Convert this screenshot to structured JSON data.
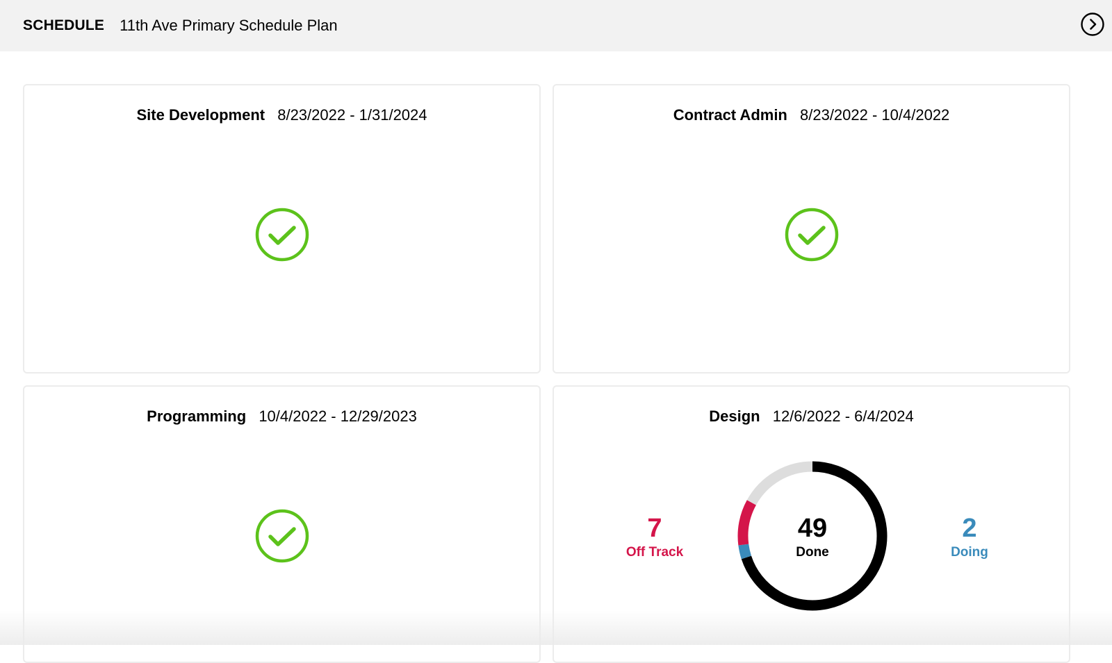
{
  "header": {
    "section_label": "SCHEDULE",
    "plan_name": "11th Ave Primary Schedule Plan",
    "nav_icon": "chevron-right-circle-icon"
  },
  "cards": [
    {
      "name": "Site Development",
      "dates": "8/23/2022 - 1/31/2024",
      "status_icon": "check-circle-icon",
      "status": "complete"
    },
    {
      "name": "Contract Admin",
      "dates": "8/23/2022 - 10/4/2022",
      "status_icon": "check-circle-icon",
      "status": "complete"
    },
    {
      "name": "Programming",
      "dates": "10/4/2022 - 12/29/2023",
      "status_icon": "check-circle-icon",
      "status": "complete"
    },
    {
      "name": "Design",
      "dates": "12/6/2022 - 6/4/2024",
      "off_track": {
        "value": "7",
        "label": "Off Track"
      },
      "done": {
        "value": "49",
        "label": "Done"
      },
      "doing": {
        "value": "2",
        "label": "Doing"
      }
    }
  ],
  "donut_progress": {
    "done_fraction": 0.7,
    "doing_fraction": 0.03,
    "off_track_fraction": 0.1,
    "remaining_fraction": 0.17
  },
  "colors": {
    "check_green": "#5cc21b",
    "off_track": "#d4154a",
    "doing": "#3a8bbb",
    "done": "#000000",
    "remaining": "#dddddd",
    "topbar_bg": "#f2f2f2"
  }
}
